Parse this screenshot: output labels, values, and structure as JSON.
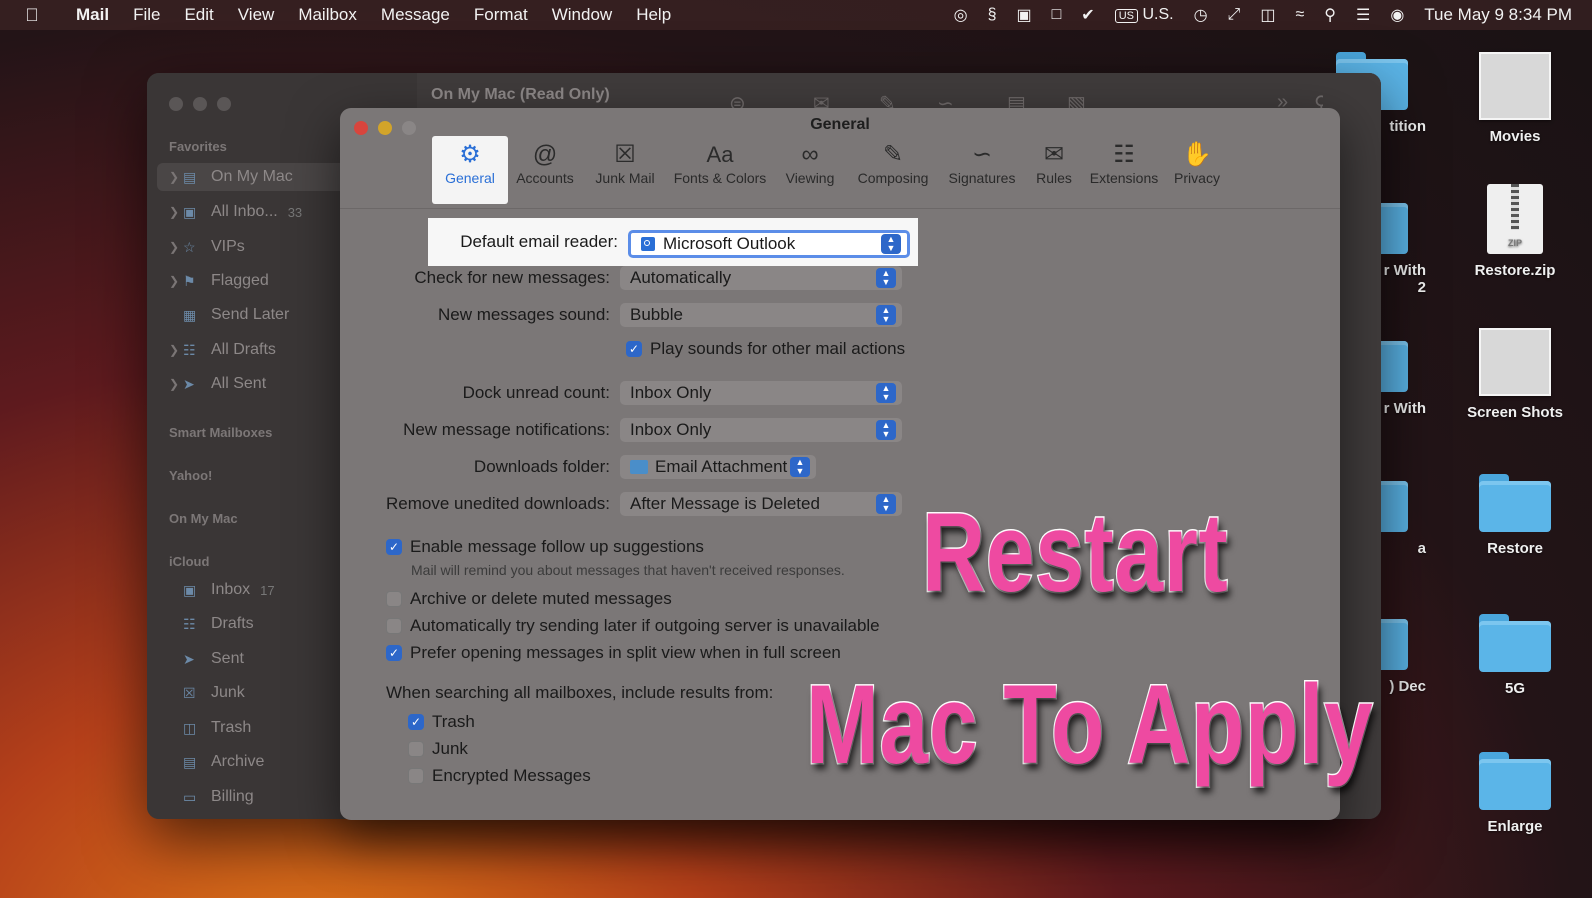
{
  "menubar": {
    "app_name": "Mail",
    "items": [
      "File",
      "Edit",
      "View",
      "Mailbox",
      "Message",
      "Format",
      "Window",
      "Help"
    ],
    "input_source_badge": "US",
    "input_source_label": "U.S.",
    "clock": "Tue May 9  8:34 PM"
  },
  "desktop": {
    "icons": [
      {
        "label": "Movies",
        "kind": "thumbnail"
      },
      {
        "label": "Restore.zip",
        "kind": "zip",
        "badge": "ZIP"
      },
      {
        "label": "Screen Shots",
        "kind": "thumbnail"
      },
      {
        "label": "Restore",
        "kind": "folder"
      },
      {
        "label": "5G",
        "kind": "folder"
      },
      {
        "label": "Enlarge",
        "kind": "folder"
      }
    ],
    "partial_labels": [
      "tition",
      "r With",
      "2",
      "r With",
      "a",
      ") Dec"
    ]
  },
  "mail_window": {
    "title": "On My Mac (Read Only)",
    "sidebar": {
      "favorites_header": "Favorites",
      "favorites": [
        {
          "label": "On My Mac",
          "count": ""
        },
        {
          "label": "All Inbo...",
          "count": "33"
        },
        {
          "label": "VIPs",
          "count": ""
        },
        {
          "label": "Flagged",
          "count": ""
        },
        {
          "label": "Send Later",
          "count": ""
        },
        {
          "label": "All Drafts",
          "count": ""
        },
        {
          "label": "All Sent",
          "count": ""
        }
      ],
      "smart_mailboxes_header": "Smart Mailboxes",
      "yahoo_header": "Yahoo!",
      "on_my_mac_header": "On My Mac",
      "icloud_header": "iCloud",
      "icloud": [
        {
          "label": "Inbox",
          "count": "17"
        },
        {
          "label": "Drafts",
          "count": ""
        },
        {
          "label": "Sent",
          "count": ""
        },
        {
          "label": "Junk",
          "count": ""
        },
        {
          "label": "Trash",
          "count": ""
        },
        {
          "label": "Archive",
          "count": ""
        },
        {
          "label": "Billing",
          "count": ""
        }
      ]
    }
  },
  "prefs": {
    "title": "General",
    "tabs": [
      {
        "label": "General",
        "icon": "gear-icon"
      },
      {
        "label": "Accounts",
        "icon": "at-icon"
      },
      {
        "label": "Junk Mail",
        "icon": "junk-icon"
      },
      {
        "label": "Fonts & Colors",
        "icon": "fonts-icon"
      },
      {
        "label": "Viewing",
        "icon": "glasses-icon"
      },
      {
        "label": "Composing",
        "icon": "compose-icon"
      },
      {
        "label": "Signatures",
        "icon": "signature-icon"
      },
      {
        "label": "Rules",
        "icon": "rules-icon"
      },
      {
        "label": "Extensions",
        "icon": "puzzle-icon"
      },
      {
        "label": "Privacy",
        "icon": "hand-icon"
      }
    ],
    "default_reader": {
      "label": "Default email reader:",
      "value": "Microsoft Outlook"
    },
    "check_messages": {
      "label": "Check for new messages:",
      "value": "Automatically"
    },
    "sound": {
      "label": "New messages sound:",
      "value": "Bubble"
    },
    "play_sounds": {
      "label": "Play sounds for other mail actions",
      "checked": true
    },
    "dock_unread": {
      "label": "Dock unread count:",
      "value": "Inbox Only"
    },
    "notifications": {
      "label": "New message notifications:",
      "value": "Inbox Only"
    },
    "downloads_folder": {
      "label": "Downloads folder:",
      "value": "Email Attachment"
    },
    "remove_downloads": {
      "label": "Remove unedited downloads:",
      "value": "After Message is Deleted"
    },
    "follow_up": {
      "label": "Enable message follow up suggestions",
      "checked": true,
      "note": "Mail will remind you about messages that haven't received responses."
    },
    "archive_muted": {
      "label": "Archive or delete muted messages",
      "checked": false
    },
    "auto_send_later": {
      "label": "Automatically try sending later if outgoing server is unavailable",
      "checked": false
    },
    "split_view": {
      "label": "Prefer opening messages in split view when in full screen",
      "checked": true
    },
    "search_header": "When searching all mailboxes, include results from:",
    "search_options": [
      {
        "label": "Trash",
        "checked": true
      },
      {
        "label": "Junk",
        "checked": false
      },
      {
        "label": "Encrypted Messages",
        "checked": false
      }
    ]
  },
  "overlay": {
    "line1": "Restart",
    "line2": "Mac To Apply",
    "color": "#ee4aa1"
  }
}
